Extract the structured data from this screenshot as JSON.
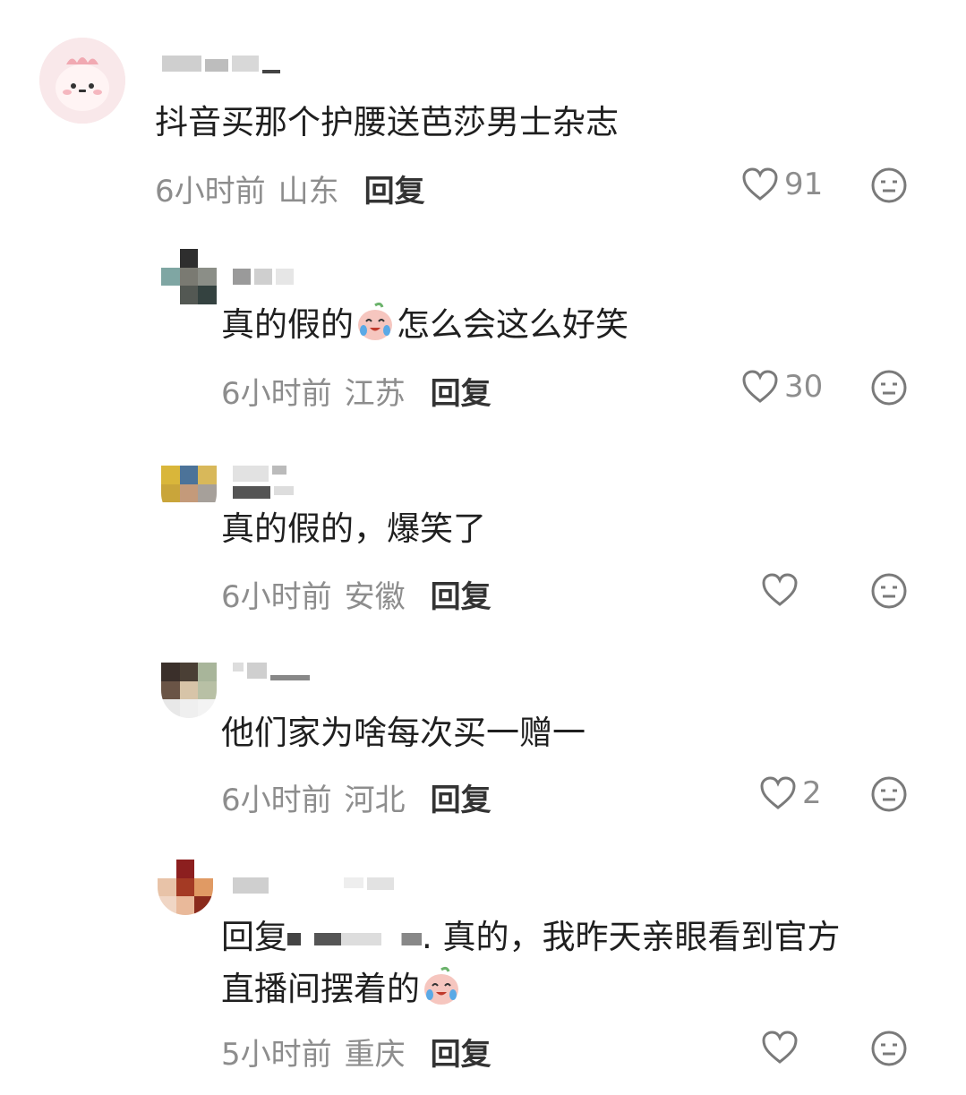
{
  "comments": [
    {
      "text": "抖音买那个护腰送芭莎男士杂志",
      "time": "6小时前",
      "location": "山东",
      "reply_label": "回复",
      "likes": "91"
    },
    {
      "text_before_emoji": "真的假的",
      "text_after_emoji": "怎么会这么好笑",
      "time": "6小时前",
      "location": "江苏",
      "reply_label": "回复",
      "likes": "30"
    },
    {
      "text": "真的假的，爆笑了",
      "time": "6小时前",
      "location": "安徽",
      "reply_label": "回复",
      "likes": ""
    },
    {
      "text": "他们家为啥每次买一赠一",
      "time": "6小时前",
      "location": "河北",
      "reply_label": "回复",
      "likes": "2"
    },
    {
      "reply_prefix": "回复",
      "text_line1_after_mention": ". 真的，我昨天亲眼看到官方",
      "text_line2": "直播间摆着的",
      "time": "5小时前",
      "location": "重庆",
      "reply_label": "回复",
      "likes": ""
    }
  ],
  "icons": {
    "like": "heart-outline-icon",
    "dislike": "meh-face-icon",
    "emoji": "crying-laughing-peach-emoji"
  },
  "colors": {
    "meta_text": "#8d8d8d",
    "body_text": "#1f1f1f",
    "reply_button": "#333333",
    "icon_stroke": "#7a7a7a"
  }
}
